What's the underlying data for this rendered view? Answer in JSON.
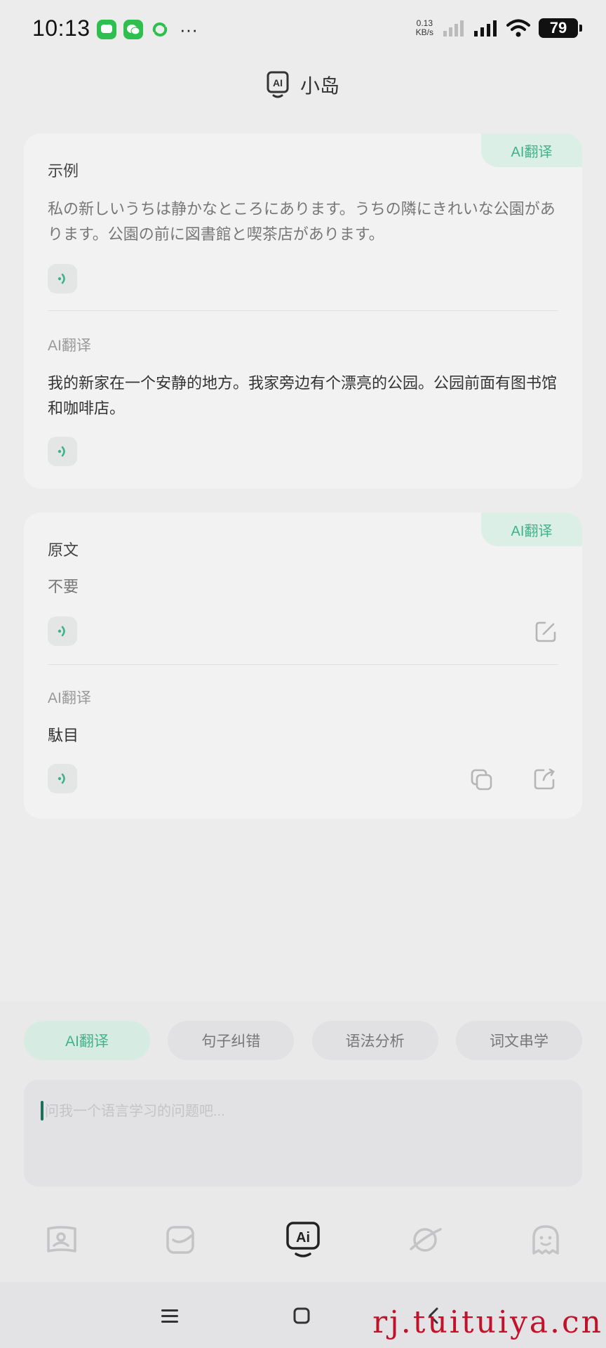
{
  "status": {
    "time": "10:13",
    "net_speed_value": "0.13",
    "net_speed_unit": "KB/s",
    "battery": "79",
    "more": "···"
  },
  "header": {
    "title": "小岛",
    "logo_text": "AI"
  },
  "card1": {
    "tag": "AI翻译",
    "title": "示例",
    "source_text": " 私の新しいうちは静かなところにあります。うちの隣にきれいな公園があります。公園の前に図書館と喫茶店があります。",
    "translation_label": "AI翻译",
    "translation_text": "我的新家在一个安静的地方。我家旁边有个漂亮的公园。公园前面有图书馆和咖啡店。"
  },
  "card2": {
    "tag": "AI翻译",
    "title": "原文",
    "source_text": "不要",
    "translation_label": "AI翻译",
    "translation_text": "駄目"
  },
  "chips": [
    {
      "label": "AI翻译",
      "active": true
    },
    {
      "label": "句子纠错",
      "active": false
    },
    {
      "label": "语法分析",
      "active": false
    },
    {
      "label": "词文串学",
      "active": false
    }
  ],
  "input": {
    "placeholder": "问我一个语言学习的问题吧..."
  },
  "tabbar": {
    "ai_tab_text": "Ai"
  },
  "watermark": "rj.tuituiya.cn",
  "colors": {
    "accent": "#3fb38a",
    "accent_bg": "#dcefe7",
    "card_bg": "#f2f2f3",
    "page_bg": "#ececed"
  }
}
